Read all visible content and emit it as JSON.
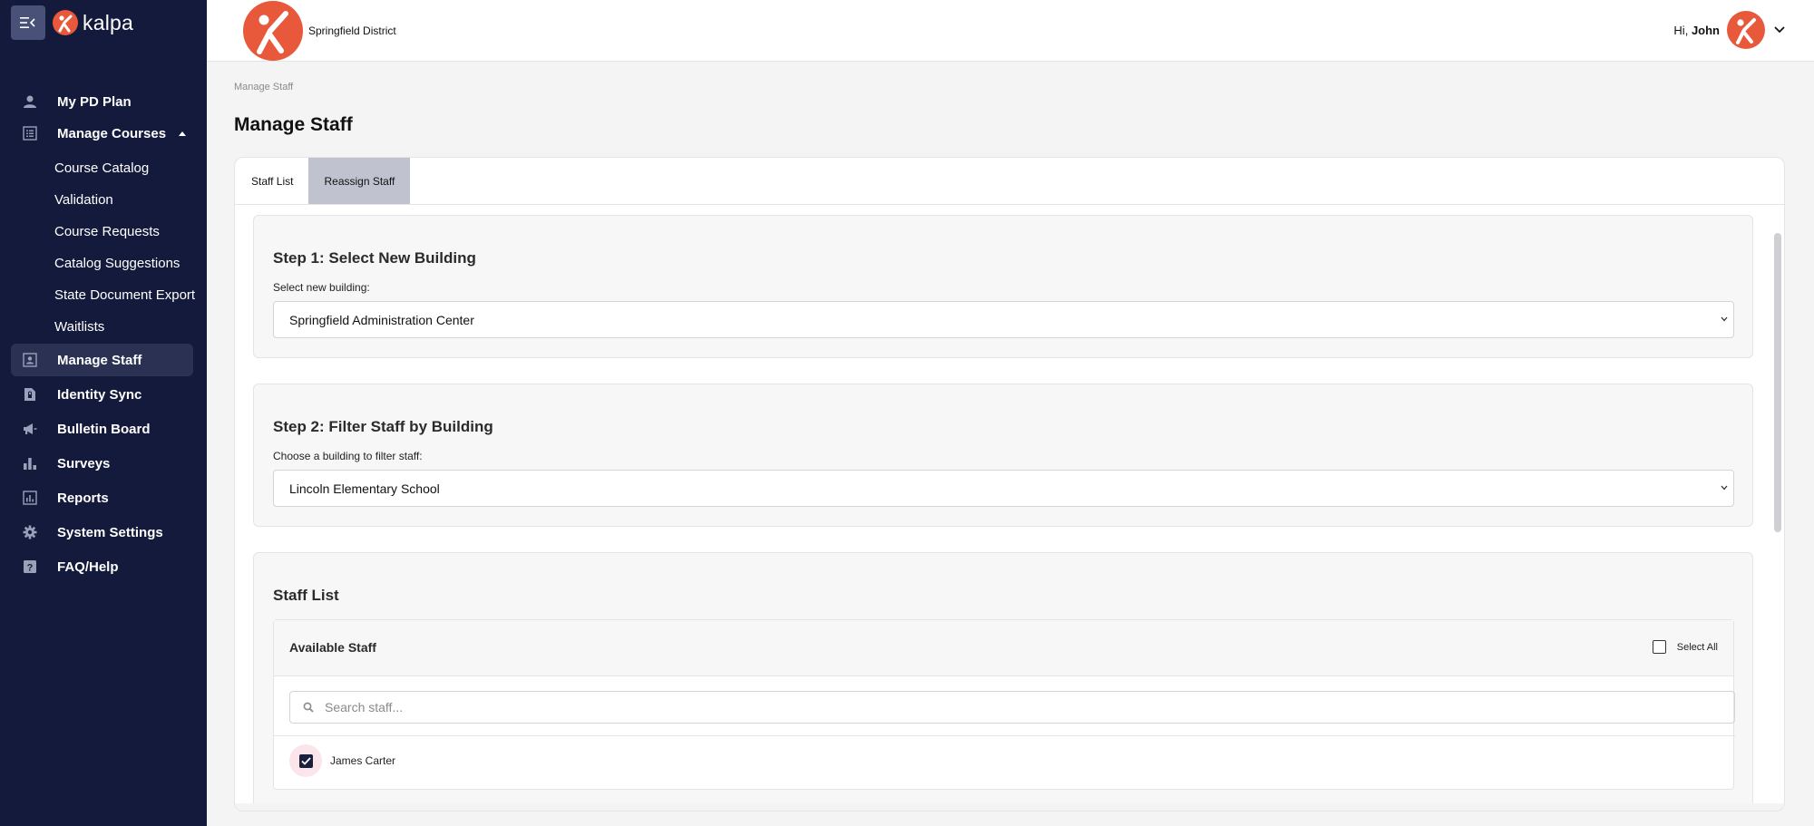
{
  "app": {
    "name": "kalpa",
    "accent": "#e8583a",
    "sidebar_bg": "#141a3c"
  },
  "sidebar": {
    "items": [
      {
        "label": "My PD Plan",
        "icon": "person-icon"
      },
      {
        "label": "Manage Courses",
        "icon": "list-icon",
        "expanded": true,
        "children": [
          "Course Catalog",
          "Validation",
          "Course Requests",
          "Catalog Suggestions",
          "State Document Export",
          "Waitlists"
        ]
      },
      {
        "label": "Manage Staff",
        "icon": "badge-icon",
        "active": true
      },
      {
        "label": "Identity Sync",
        "icon": "file-lock-icon"
      },
      {
        "label": "Bulletin Board",
        "icon": "megaphone-icon"
      },
      {
        "label": "Surveys",
        "icon": "bar-chart-icon"
      },
      {
        "label": "Reports",
        "icon": "report-chart-icon"
      },
      {
        "label": "System Settings",
        "icon": "gear-icon"
      },
      {
        "label": "FAQ/Help",
        "icon": "help-icon"
      }
    ]
  },
  "header": {
    "district": "Springfield District",
    "greeting_prefix": "Hi,",
    "user_name": "John"
  },
  "breadcrumb": "Manage Staff",
  "page_title": "Manage Staff",
  "tabs": [
    {
      "label": "Staff List",
      "active": false
    },
    {
      "label": "Reassign Staff",
      "active": true
    }
  ],
  "step1": {
    "title": "Step 1: Select New Building",
    "label": "Select new building:",
    "value": "Springfield Administration Center"
  },
  "step2": {
    "title": "Step 2: Filter Staff by Building",
    "label": "Choose a building to filter staff:",
    "value": "Lincoln Elementary School"
  },
  "staff_list": {
    "title": "Staff List",
    "header": "Available Staff",
    "select_all": "Select All",
    "search_placeholder": "Search staff...",
    "staff": [
      {
        "name": "James Carter",
        "checked": true
      }
    ]
  }
}
